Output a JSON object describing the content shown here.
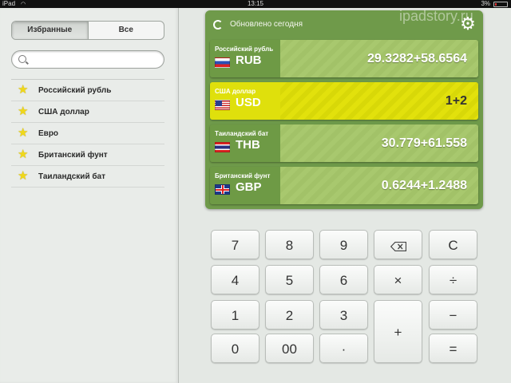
{
  "statusbar": {
    "device": "iPad",
    "time": "13:15",
    "battery": "3%"
  },
  "sidebar": {
    "segments": [
      "Избранные",
      "Все"
    ],
    "active_segment": 0,
    "search": {
      "value": "",
      "placeholder": ""
    },
    "items": [
      {
        "label": "Российский рубль"
      },
      {
        "label": "США доллар"
      },
      {
        "label": "Евро"
      },
      {
        "label": "Британский фунт"
      },
      {
        "label": "Таиландский бат"
      }
    ]
  },
  "watermark": "ipadstory.ru",
  "panel": {
    "updated": "Обновлено сегодня",
    "rows": [
      {
        "name": "Российский рубль",
        "code": "RUB",
        "value": "29.3282+58.6564",
        "flag": "ru",
        "selected": false
      },
      {
        "name": "США доллар",
        "code": "USD",
        "value": "1+2",
        "flag": "us",
        "selected": true
      },
      {
        "name": "Таиландский бат",
        "code": "THB",
        "value": "30.779+61.558",
        "flag": "th",
        "selected": false
      },
      {
        "name": "Британский фунт",
        "code": "GBP",
        "value": "0.6244+1.2488",
        "flag": "gb",
        "selected": false
      }
    ]
  },
  "keypad": {
    "k7": "7",
    "k8": "8",
    "k9": "9",
    "backspace": "backspace-icon",
    "clear": "C",
    "k4": "4",
    "k5": "5",
    "k6": "6",
    "multiply": "×",
    "divide": "÷",
    "k1": "1",
    "k2": "2",
    "k3": "3",
    "plus": "+",
    "minus": "−",
    "k0": "0",
    "k00": "00",
    "dot": "·",
    "equals": "="
  },
  "colors": {
    "panel_green": "#6f9a4a",
    "row_green": "#a8c86e",
    "selected_yellow": "#e2e10c",
    "star": "#f0d81a"
  }
}
